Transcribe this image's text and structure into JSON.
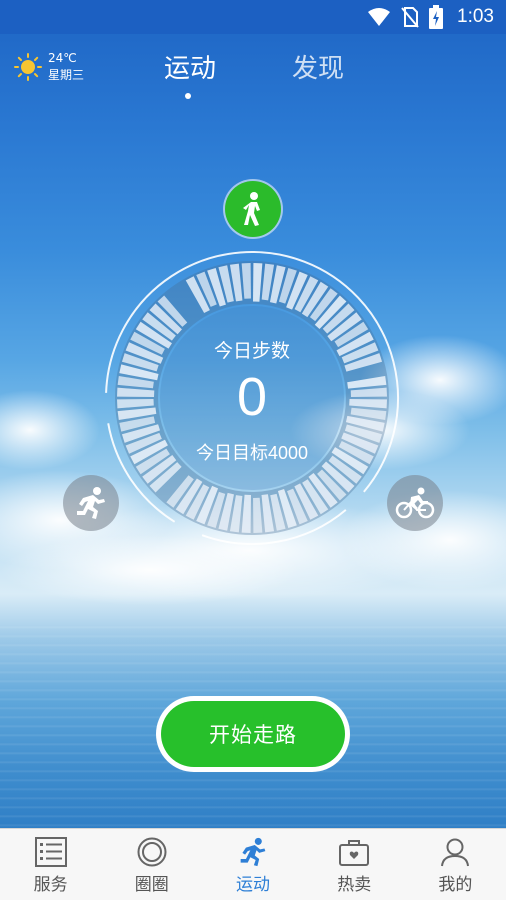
{
  "status_bar": {
    "time": "1:03",
    "icons": [
      "wifi-icon",
      "no-sim-icon",
      "battery-charging-icon"
    ]
  },
  "weather": {
    "icon": "sun-icon",
    "temperature": "24℃",
    "weekday": "星期三"
  },
  "tabs": [
    {
      "label": "运动",
      "active": true
    },
    {
      "label": "发现",
      "active": false
    }
  ],
  "dial": {
    "steps_label": "今日步数",
    "steps_value": "0",
    "goal_prefix": "今日目标",
    "goal_value": "4000",
    "progress_fraction": 0
  },
  "modes": [
    {
      "name": "walk",
      "icon": "walking-icon",
      "active": true
    },
    {
      "name": "run",
      "icon": "running-icon",
      "active": false
    },
    {
      "name": "bike",
      "icon": "cycling-icon",
      "active": false
    }
  ],
  "start_button": {
    "label": "开始走路"
  },
  "bottom_nav": [
    {
      "label": "服务",
      "icon": "list-icon",
      "active": false
    },
    {
      "label": "圈圈",
      "icon": "circle-icon",
      "active": false
    },
    {
      "label": "运动",
      "icon": "running-icon",
      "active": true
    },
    {
      "label": "热卖",
      "icon": "shopping-bag-icon",
      "active": false
    },
    {
      "label": "我的",
      "icon": "person-icon",
      "active": false
    }
  ],
  "colors": {
    "accent_green": "#27c02b",
    "accent_blue": "#2e7fd6",
    "status_bar": "#1c60c2"
  }
}
